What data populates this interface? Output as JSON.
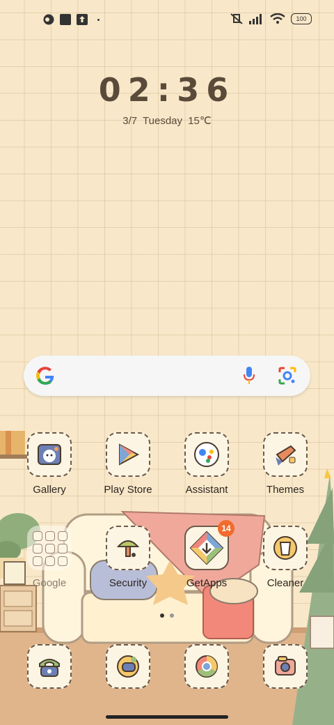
{
  "status_bar": {
    "battery": "100",
    "left_icons": [
      "app-notification-icon",
      "square-icon",
      "upload-icon",
      "dot"
    ],
    "right_icons": [
      "mute-icon",
      "signal-icon",
      "wifi-icon",
      "battery-icon"
    ]
  },
  "clock": {
    "time": "02:36",
    "date": "3/7  Tuesday  15℃"
  },
  "search": {
    "icons": [
      "google-g-icon",
      "mic-icon",
      "lens-icon"
    ]
  },
  "apps_row1": [
    {
      "label": "Gallery"
    },
    {
      "label": "Play Store"
    },
    {
      "label": "Assistant"
    },
    {
      "label": "Themes"
    }
  ],
  "apps_row2": [
    {
      "label": "Google"
    },
    {
      "label": "Security"
    },
    {
      "label": "GetApps",
      "badge": "14"
    },
    {
      "label": "Cleaner"
    }
  ],
  "dock": [
    {
      "name": "phone-icon"
    },
    {
      "name": "messages-icon"
    },
    {
      "name": "browser-icon"
    },
    {
      "name": "camera-icon"
    }
  ],
  "colors": {
    "background": "#f8e8c9",
    "grid": "#d6bc96",
    "text": "#5a4a3a",
    "badge": "#f26b2e"
  },
  "pages": {
    "current": 1,
    "total": 2
  }
}
